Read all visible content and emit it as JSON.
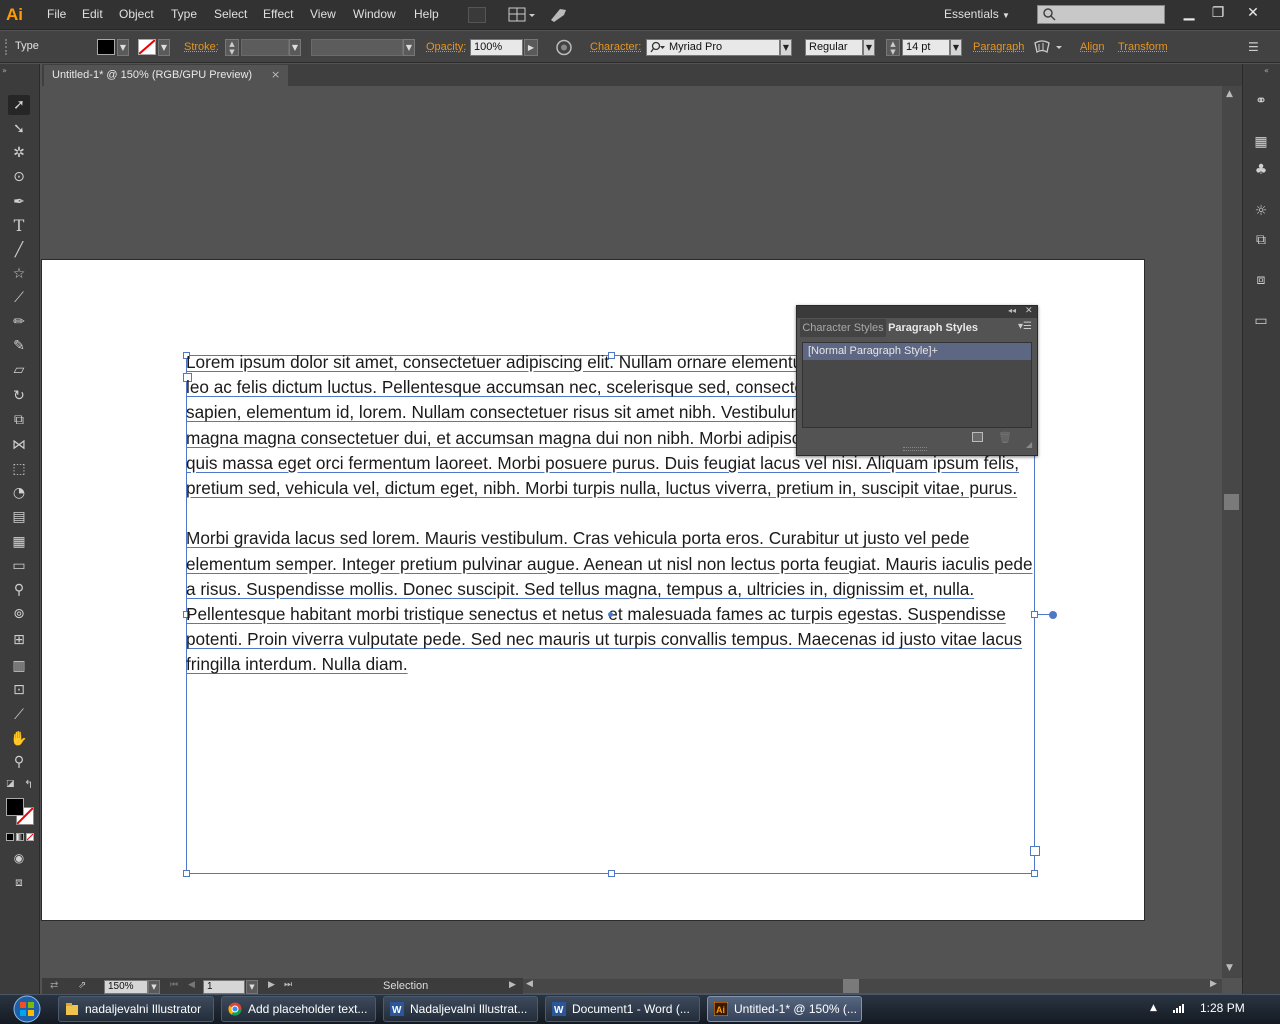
{
  "app": {
    "logo": "Ai",
    "menus": [
      "File",
      "Edit",
      "Object",
      "Type",
      "Select",
      "Effect",
      "View",
      "Window",
      "Help"
    ],
    "workspace": "Essentials",
    "search_placeholder": ""
  },
  "control_bar": {
    "tool_label": "Type",
    "stroke_label": "Stroke:",
    "opacity_label": "Opacity:",
    "opacity_value": "100%",
    "character_label": "Character:",
    "font_family": "Myriad Pro",
    "font_style": "Regular",
    "font_size": "14 pt",
    "paragraph_label": "Paragraph",
    "align_label": "Align",
    "transform_label": "Transform"
  },
  "document_tab": {
    "title": "Untitled-1* @ 150% (RGB/GPU Preview)",
    "close": "×"
  },
  "text_frame": {
    "paragraphs": [
      "Lorem ipsum dolor sit amet, consectetuer adipiscing elit. Nullam ornare elementum suscipit nisl. Cras imperdiet leo ac felis dictum luctus. Pellentesque accumsan nec, scelerisque sed, consectetuer nec, justo. Sed tortor sapien, elementum id, lorem. Nullam consectetuer risus sit amet nibh. Vestibulum vitae euismod volutpat, magna magna consectetuer dui, et accumsan magna dui non nibh. Morbi adipiscing consequat erat. Vivamus quis massa eget orci fermentum laoreet. Morbi posuere purus. Duis feugiat lacus vel nisi. Aliquam ipsum felis, pretium sed, vehicula vel, dictum eget, nibh. Morbi turpis nulla, luctus viverra, pretium in, suscipit vitae, purus.",
      "Morbi gravida lacus sed lorem. Mauris vestibulum. Cras vehicula porta eros. Curabitur ut justo vel pede elementum semper. Integer pretium pulvinar augue. Aenean ut nisl non lectus porta feugiat. Mauris iaculis pede a risus. Suspendisse mollis. Donec suscipit. Sed tellus magna, tempus a, ultricies in, dignissim et, nulla. Pellentesque habitant morbi tristique senectus et netus et malesuada fames ac turpis egestas. Suspendisse potenti. Proin viverra vulputate pede. Sed nec mauris ut turpis convallis tempus. Maecenas id justo vitae lacus fringilla interdum. Nulla diam."
    ]
  },
  "styles_panel": {
    "tabs": [
      "Character Styles",
      "Paragraph Styles"
    ],
    "active_tab": "Paragraph Styles",
    "items": [
      "[Normal Paragraph Style]+"
    ]
  },
  "status_bar": {
    "zoom": "150%",
    "artboard_number": "1",
    "mode": "Selection"
  },
  "taskbar": {
    "items": [
      {
        "label": "nadaljevalni Illustrator",
        "icon": "folder-icon"
      },
      {
        "label": "Add placeholder text...",
        "icon": "chrome-icon"
      },
      {
        "label": "Nadaljevalni Illustrat...",
        "icon": "word-icon"
      },
      {
        "label": "Document1 - Word (...",
        "icon": "word-icon"
      },
      {
        "label": "Untitled-1* @ 150% (...",
        "icon": "illustrator-icon"
      }
    ],
    "clock": "1:28 PM"
  },
  "colors": {
    "accent_orange": "#e8951e",
    "selection_blue": "#4f79c7",
    "ai_logo": "#ff9a00"
  }
}
